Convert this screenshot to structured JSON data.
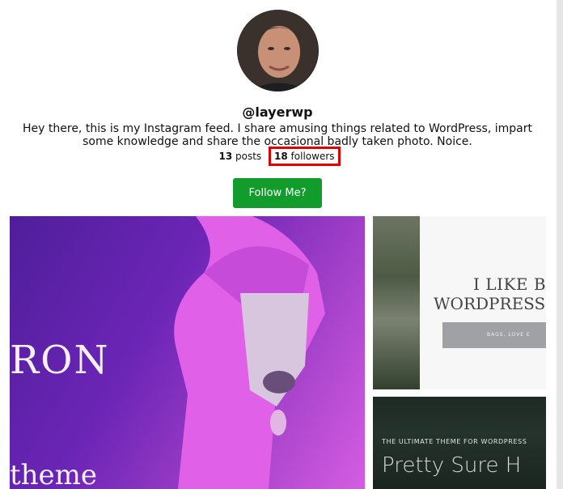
{
  "profile": {
    "username": "@layerwp",
    "bio": "Hey there, this is my Instagram feed. I share amusing things related to WordPress, impart some knowledge and share the occasional badly taken photo. Noice.",
    "posts_count": "13",
    "posts_label": "posts",
    "followers_count": "18",
    "followers_label": "followers",
    "follow_button_label": "Follow Me?"
  },
  "feed": {
    "tile_main": {
      "text_large": "RON",
      "text_small": "theme"
    },
    "tile_right1": {
      "line1": "I LIKE BA",
      "line2": "WORDPRESS",
      "band_text": "BAGS, LOVE E"
    },
    "tile_right2": {
      "kicker": "THE ULTIMATE THEME FOR WORDPRESS",
      "headline": "Pretty Sure H"
    }
  },
  "colors": {
    "follow_button": "#119c2c",
    "highlight_outline": "#e00000"
  }
}
